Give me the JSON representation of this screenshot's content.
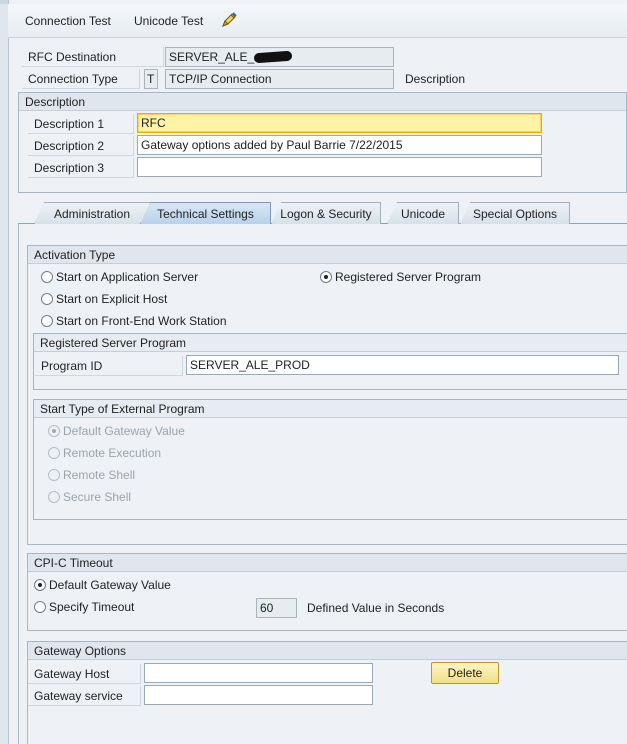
{
  "toolbar": {
    "connection_test": "Connection Test",
    "unicode_test": "Unicode Test",
    "tool_icon": "pencil-tool-icon"
  },
  "header": {
    "rfc_destination_label": "RFC Destination",
    "rfc_destination_value": "SERVER_ALE_",
    "connection_type_label": "Connection Type",
    "connection_type_code": "T",
    "connection_type_value": "TCP/IP Connection",
    "description_label": "Description"
  },
  "description_group": {
    "title": "Description",
    "desc1_label": "Description 1",
    "desc1_value": "RFC",
    "desc2_label": "Description 2",
    "desc2_value": "Gateway options added by Paul Barrie 7/22/2015",
    "desc3_label": "Description 3",
    "desc3_value": ""
  },
  "tabs": [
    {
      "label": "Administration"
    },
    {
      "label": "Technical Settings",
      "active": true
    },
    {
      "label": "Logon & Security"
    },
    {
      "label": "Unicode"
    },
    {
      "label": "Special Options"
    }
  ],
  "activation": {
    "title": "Activation Type",
    "opt_app_server": "Start on Application Server",
    "opt_registered": "Registered Server Program",
    "opt_explicit_host": "Start on Explicit Host",
    "opt_frontend": "Start on Front-End Work Station",
    "selected": "Registered Server Program"
  },
  "registered_program": {
    "title": "Registered Server Program",
    "program_id_label": "Program ID",
    "program_id_value": "SERVER_ALE_PROD"
  },
  "start_type": {
    "title": "Start Type of External Program",
    "opt_default": "Default Gateway Value",
    "opt_remote_exec": "Remote Execution",
    "opt_remote_shell": "Remote Shell",
    "opt_secure_shell": "Secure Shell",
    "selected": "Default Gateway Value"
  },
  "cpic": {
    "title": "CPI-C Timeout",
    "opt_default": "Default Gateway Value",
    "opt_specify": "Specify Timeout",
    "timeout_value": "60",
    "timeout_unit_label": "Defined Value in Seconds",
    "selected": "Default Gateway Value"
  },
  "gateway": {
    "title": "Gateway Options",
    "host_label": "Gateway Host",
    "host_value": "",
    "service_label": "Gateway service",
    "service_value": "",
    "delete_label": "Delete"
  },
  "colors": {
    "focus_field": "#fff3a6",
    "tab_active": "#b9d2ea",
    "delete_button": "#f3df82"
  }
}
